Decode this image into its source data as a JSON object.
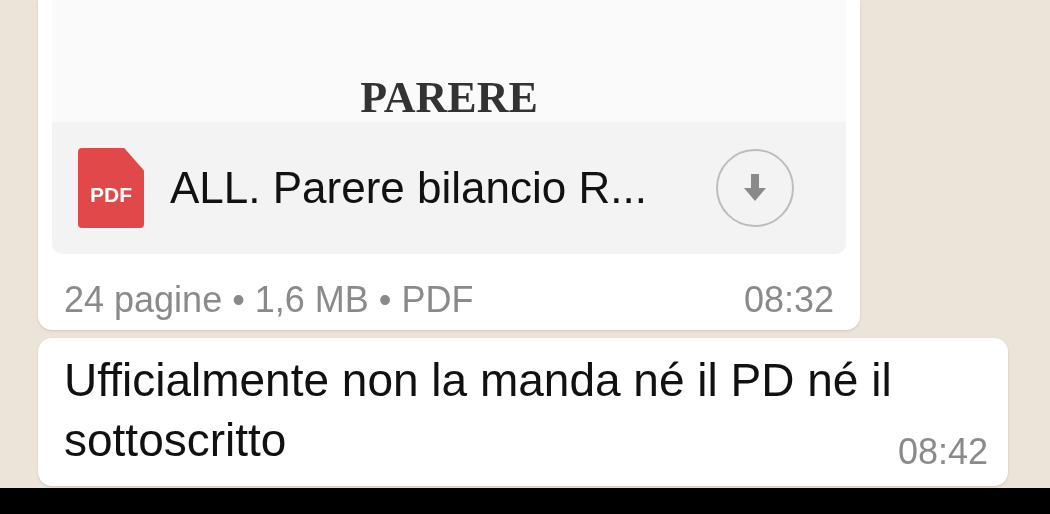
{
  "messages": [
    {
      "kind": "document",
      "preview_title": "PARERE",
      "file_badge": "PDF",
      "file_name": "ALL. Parere bilancio R...",
      "details": "24 pagine • 1,6 MB • PDF",
      "time": "08:32"
    },
    {
      "kind": "text",
      "text": "Ufficialmente non la manda né il PD né il sottoscritto",
      "time": "08:42"
    }
  ]
}
